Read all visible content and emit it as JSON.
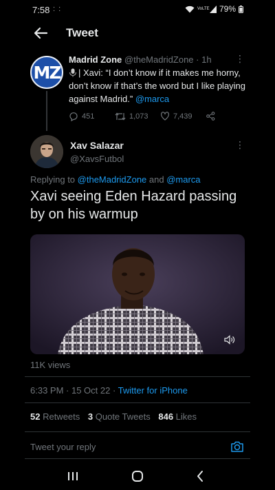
{
  "status_bar": {
    "time": "7:58",
    "indicators": ": :",
    "network": "VoLTE",
    "battery": "79%"
  },
  "header": {
    "title": "Tweet"
  },
  "quoted_tweet": {
    "avatar_text": "MZ",
    "author": "Madrid Zone",
    "handle": "@theMadridZone",
    "separator": "·",
    "time": "1h",
    "more": "⋮",
    "text_after_icon": "| Xavi: “I don’t know if it makes me horny, don’t know if that’s the word but I like playing against Madrid.” ",
    "mention": "@marca",
    "replies": "451",
    "retweets": "1,073",
    "likes": "7,439"
  },
  "tweet": {
    "author": "Xav Salazar",
    "handle": "@XavsFutbol",
    "more": "⋮",
    "replying_prefix": "Replying to ",
    "replying_user1": "@theMadridZone",
    "replying_and": " and ",
    "replying_user2": "@marca",
    "text": "Xavi seeing Eden Hazard passing by on his warmup",
    "views": "11K views",
    "timestamp": "6:33 PM · 15 Oct 22 · ",
    "source": "Twitter for iPhone",
    "retweets_count": "52",
    "retweets_label": " Retweets",
    "quotes_count": "3",
    "quotes_label": " Quote Tweets",
    "likes_count": "846",
    "likes_label": " Likes"
  },
  "reply": {
    "placeholder": "Tweet your reply"
  },
  "colors": {
    "accent": "#1d9bf0",
    "secondary_text": "#71767b",
    "background": "#000000"
  },
  "icons": [
    "back-arrow-icon",
    "mic-emoji-icon",
    "reply-icon",
    "retweet-icon",
    "like-icon",
    "share-icon",
    "volume-icon",
    "camera-icon",
    "recents-icon",
    "home-icon",
    "back-nav-icon"
  ]
}
